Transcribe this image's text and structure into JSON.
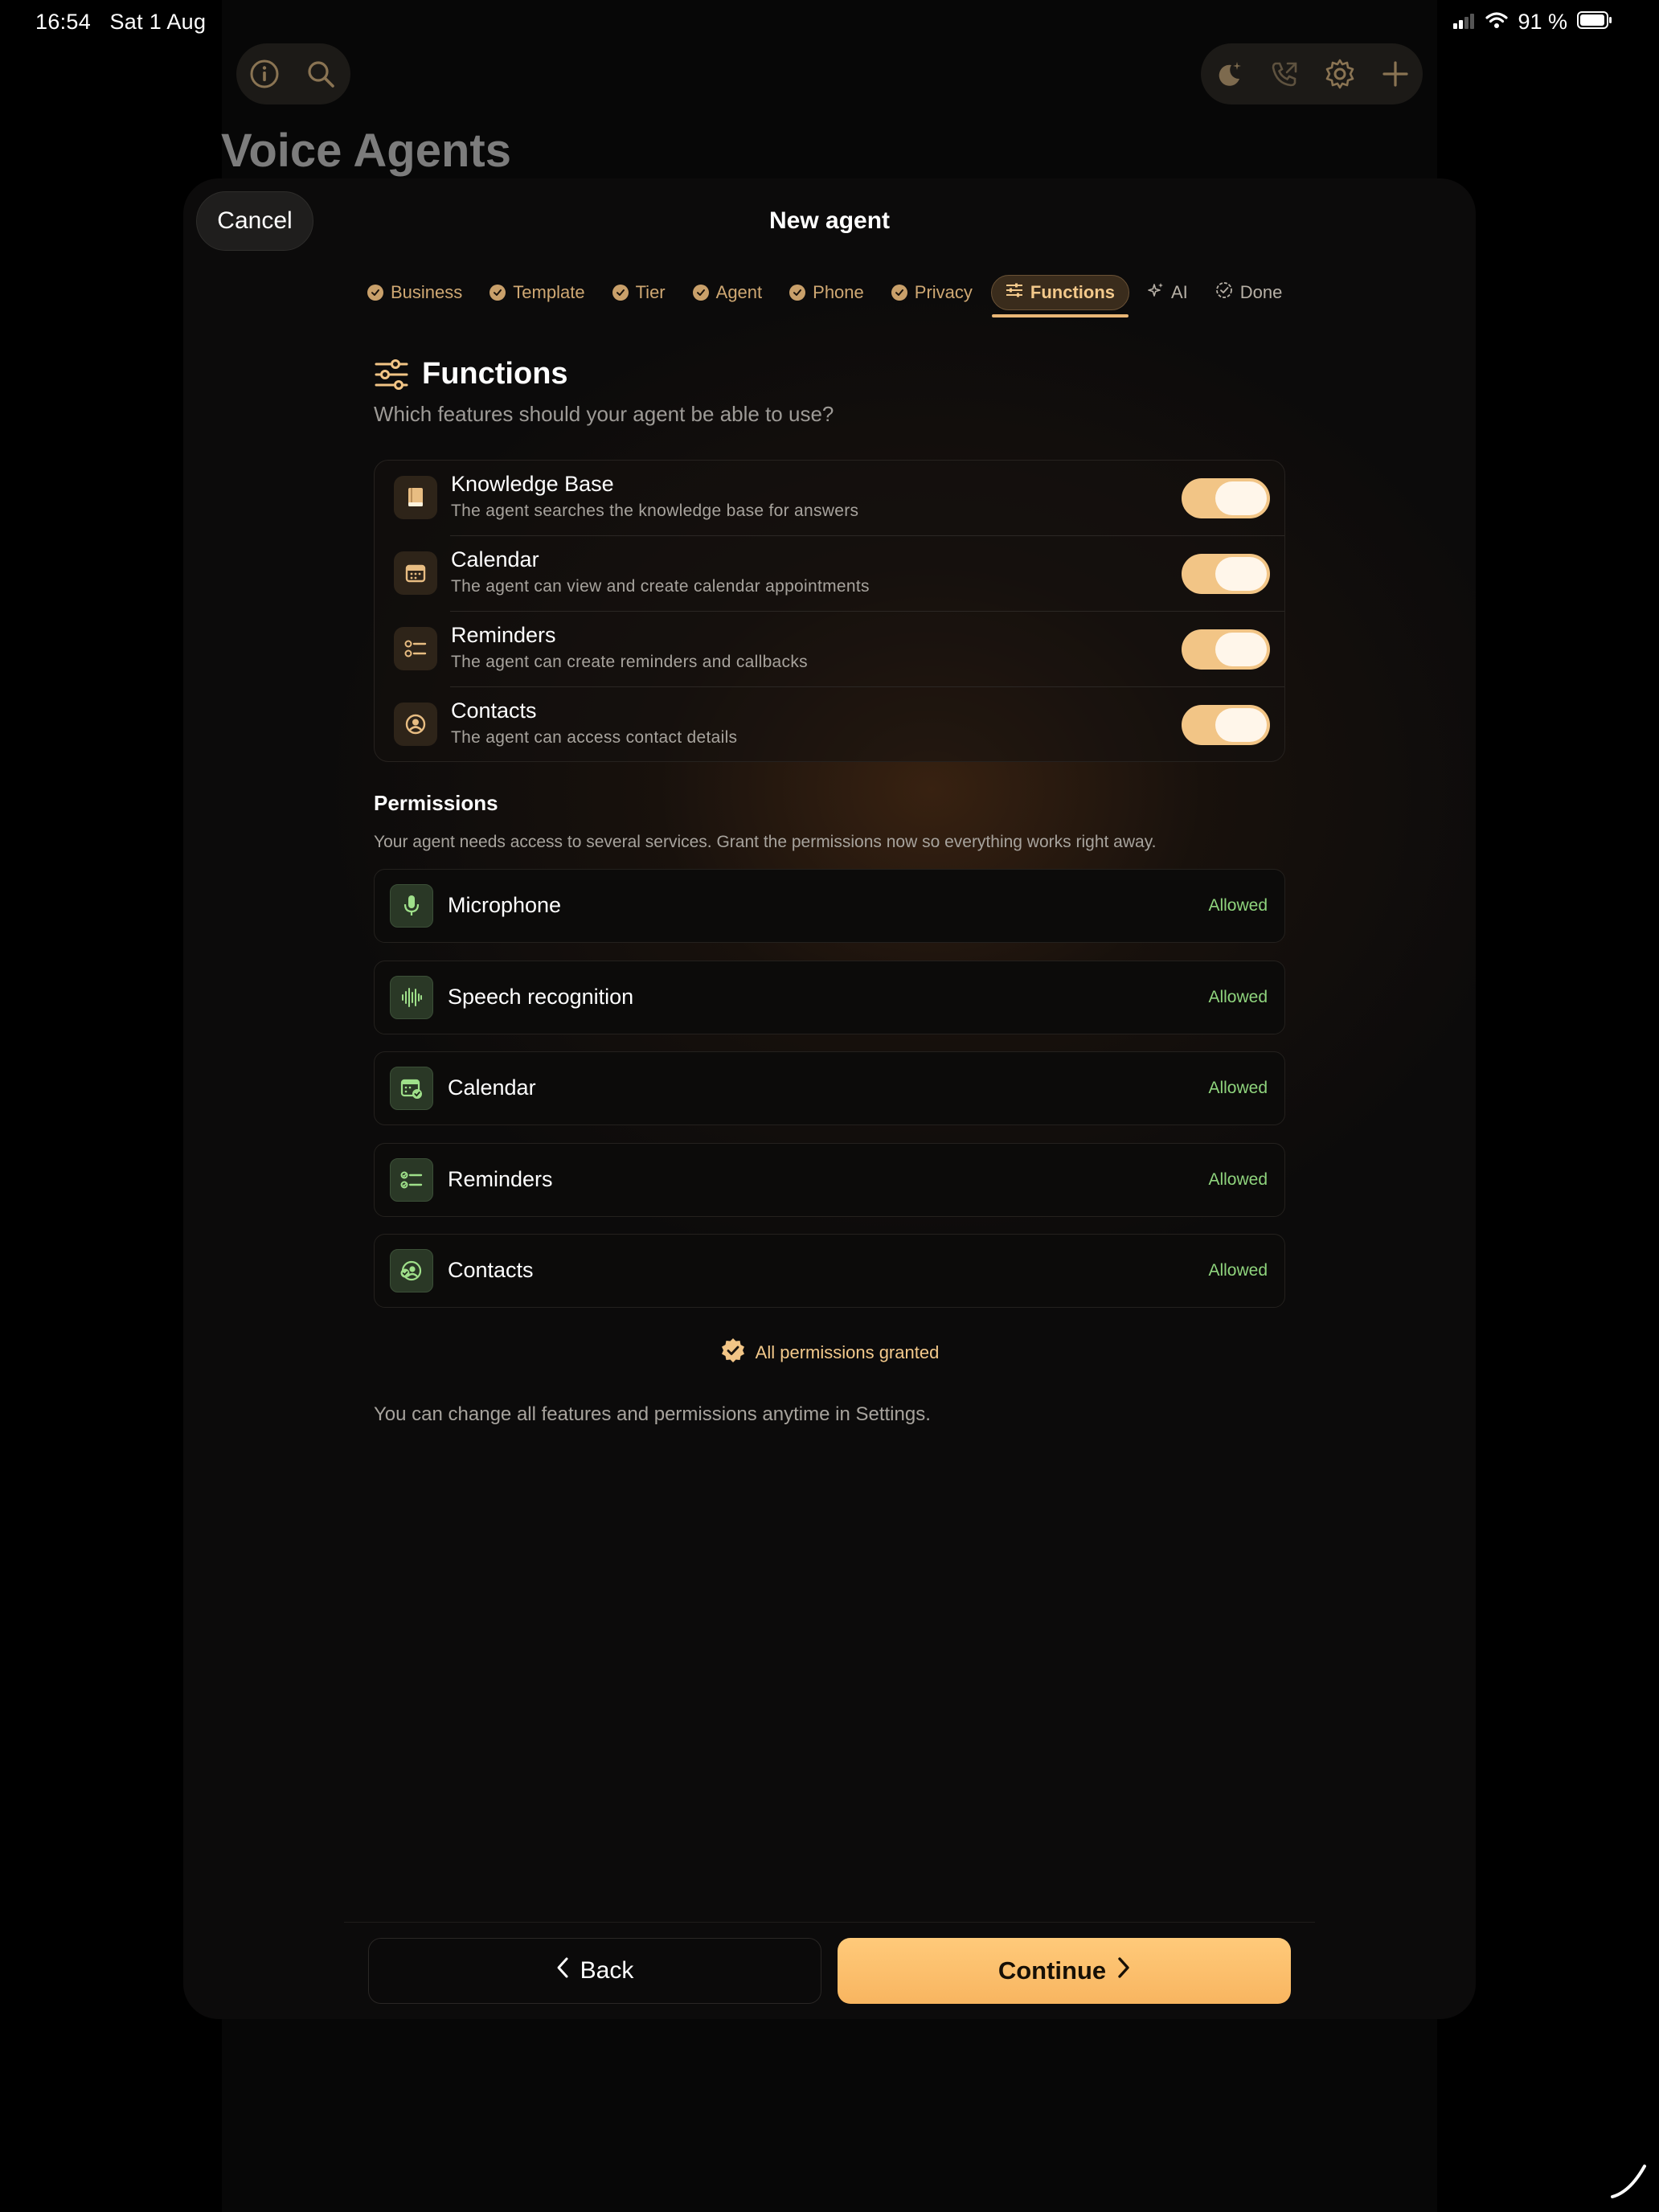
{
  "status_bar": {
    "time": "16:54",
    "date": "Sat 1 Aug",
    "battery": "91 %"
  },
  "background": {
    "title": "Voice Agents",
    "left_icons": [
      "info-icon",
      "search-icon"
    ],
    "right_icons": [
      "moon-sparkle-icon",
      "phone-outgoing-icon",
      "gear-icon",
      "plus-icon"
    ]
  },
  "sheet": {
    "cancel_label": "Cancel",
    "title": "New agent",
    "steps": [
      {
        "label": "Business",
        "state": "done"
      },
      {
        "label": "Template",
        "state": "done"
      },
      {
        "label": "Tier",
        "state": "done"
      },
      {
        "label": "Agent",
        "state": "done"
      },
      {
        "label": "Phone",
        "state": "done"
      },
      {
        "label": "Privacy",
        "state": "done"
      },
      {
        "label": "Functions",
        "state": "active"
      },
      {
        "label": "AI",
        "state": "pending"
      },
      {
        "label": "Done",
        "state": "pending"
      }
    ],
    "section_title": "Functions",
    "section_subtitle": "Which features should your agent be able to use?",
    "features": [
      {
        "title": "Knowledge Base",
        "desc": "The agent searches the knowledge base for answers",
        "icon": "book-icon",
        "enabled": true
      },
      {
        "title": "Calendar",
        "desc": "The agent can view and create calendar appointments",
        "icon": "calendar-icon",
        "enabled": true
      },
      {
        "title": "Reminders",
        "desc": "The agent can create reminders and callbacks",
        "icon": "checklist-icon",
        "enabled": true
      },
      {
        "title": "Contacts",
        "desc": "The agent can access contact details",
        "icon": "person-circle-icon",
        "enabled": true
      }
    ],
    "permissions_title": "Permissions",
    "permissions_desc": "Your agent needs access to several services. Grant the permissions now so everything works right away.",
    "permissions": [
      {
        "label": "Microphone",
        "status": "Allowed",
        "icon": "microphone-icon"
      },
      {
        "label": "Speech recognition",
        "status": "Allowed",
        "icon": "waveform-icon"
      },
      {
        "label": "Calendar",
        "status": "Allowed",
        "icon": "calendar-check-icon"
      },
      {
        "label": "Reminders",
        "status": "Allowed",
        "icon": "checklist-icon"
      },
      {
        "label": "Contacts",
        "status": "Allowed",
        "icon": "contact-check-icon"
      }
    ],
    "granted_label": "All permissions granted",
    "footnote": "You can change all features and permissions anytime in Settings.",
    "back_label": "Back",
    "continue_label": "Continue"
  },
  "colors": {
    "accent": "#f2c586",
    "allowed": "#8fd47d",
    "background": "#0c0b0b"
  }
}
